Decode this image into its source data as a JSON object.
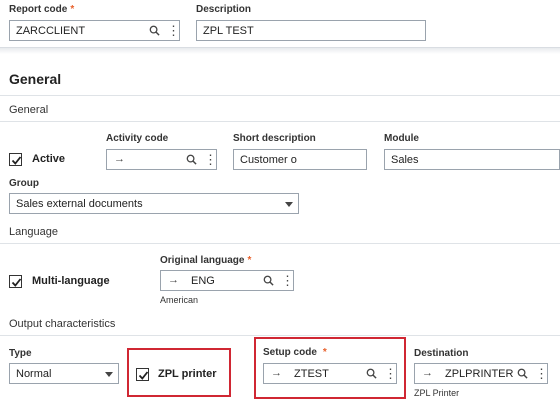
{
  "header": {
    "report_code": {
      "label": "Report code",
      "required_mark": "*",
      "value": "ZARCCLIENT"
    },
    "description": {
      "label": "Description",
      "value": "ZPL TEST"
    }
  },
  "section": {
    "title": "General"
  },
  "general": {
    "group_title": "General",
    "active": {
      "label": "Active",
      "checked": true
    },
    "activity_code": {
      "label": "Activity code",
      "value": ""
    },
    "short_description": {
      "label": "Short description",
      "value": "Customer o"
    },
    "module": {
      "label": "Module",
      "value": "Sales"
    },
    "group": {
      "label": "Group",
      "value": "Sales external documents"
    }
  },
  "language": {
    "group_title": "Language",
    "multi_language": {
      "label": "Multi-language",
      "checked": true
    },
    "original_language": {
      "label": "Original language",
      "required_mark": "*",
      "value": "ENG",
      "sub_text": "American"
    }
  },
  "output": {
    "group_title": "Output characteristics",
    "type": {
      "label": "Type",
      "value": "Normal"
    },
    "zpl_printer": {
      "label": "ZPL printer",
      "checked": true
    },
    "setup_code": {
      "label": "Setup code",
      "required_mark": "*",
      "value": "ZTEST"
    },
    "destination": {
      "label": "Destination",
      "value": "ZPLPRINTER",
      "sub_text": "ZPL Printer"
    }
  },
  "icons": {
    "arrow": "→",
    "kebab": "⋮"
  },
  "colors": {
    "required": "#e8612c",
    "highlight": "#d02733",
    "border": "#9aa3ad"
  }
}
